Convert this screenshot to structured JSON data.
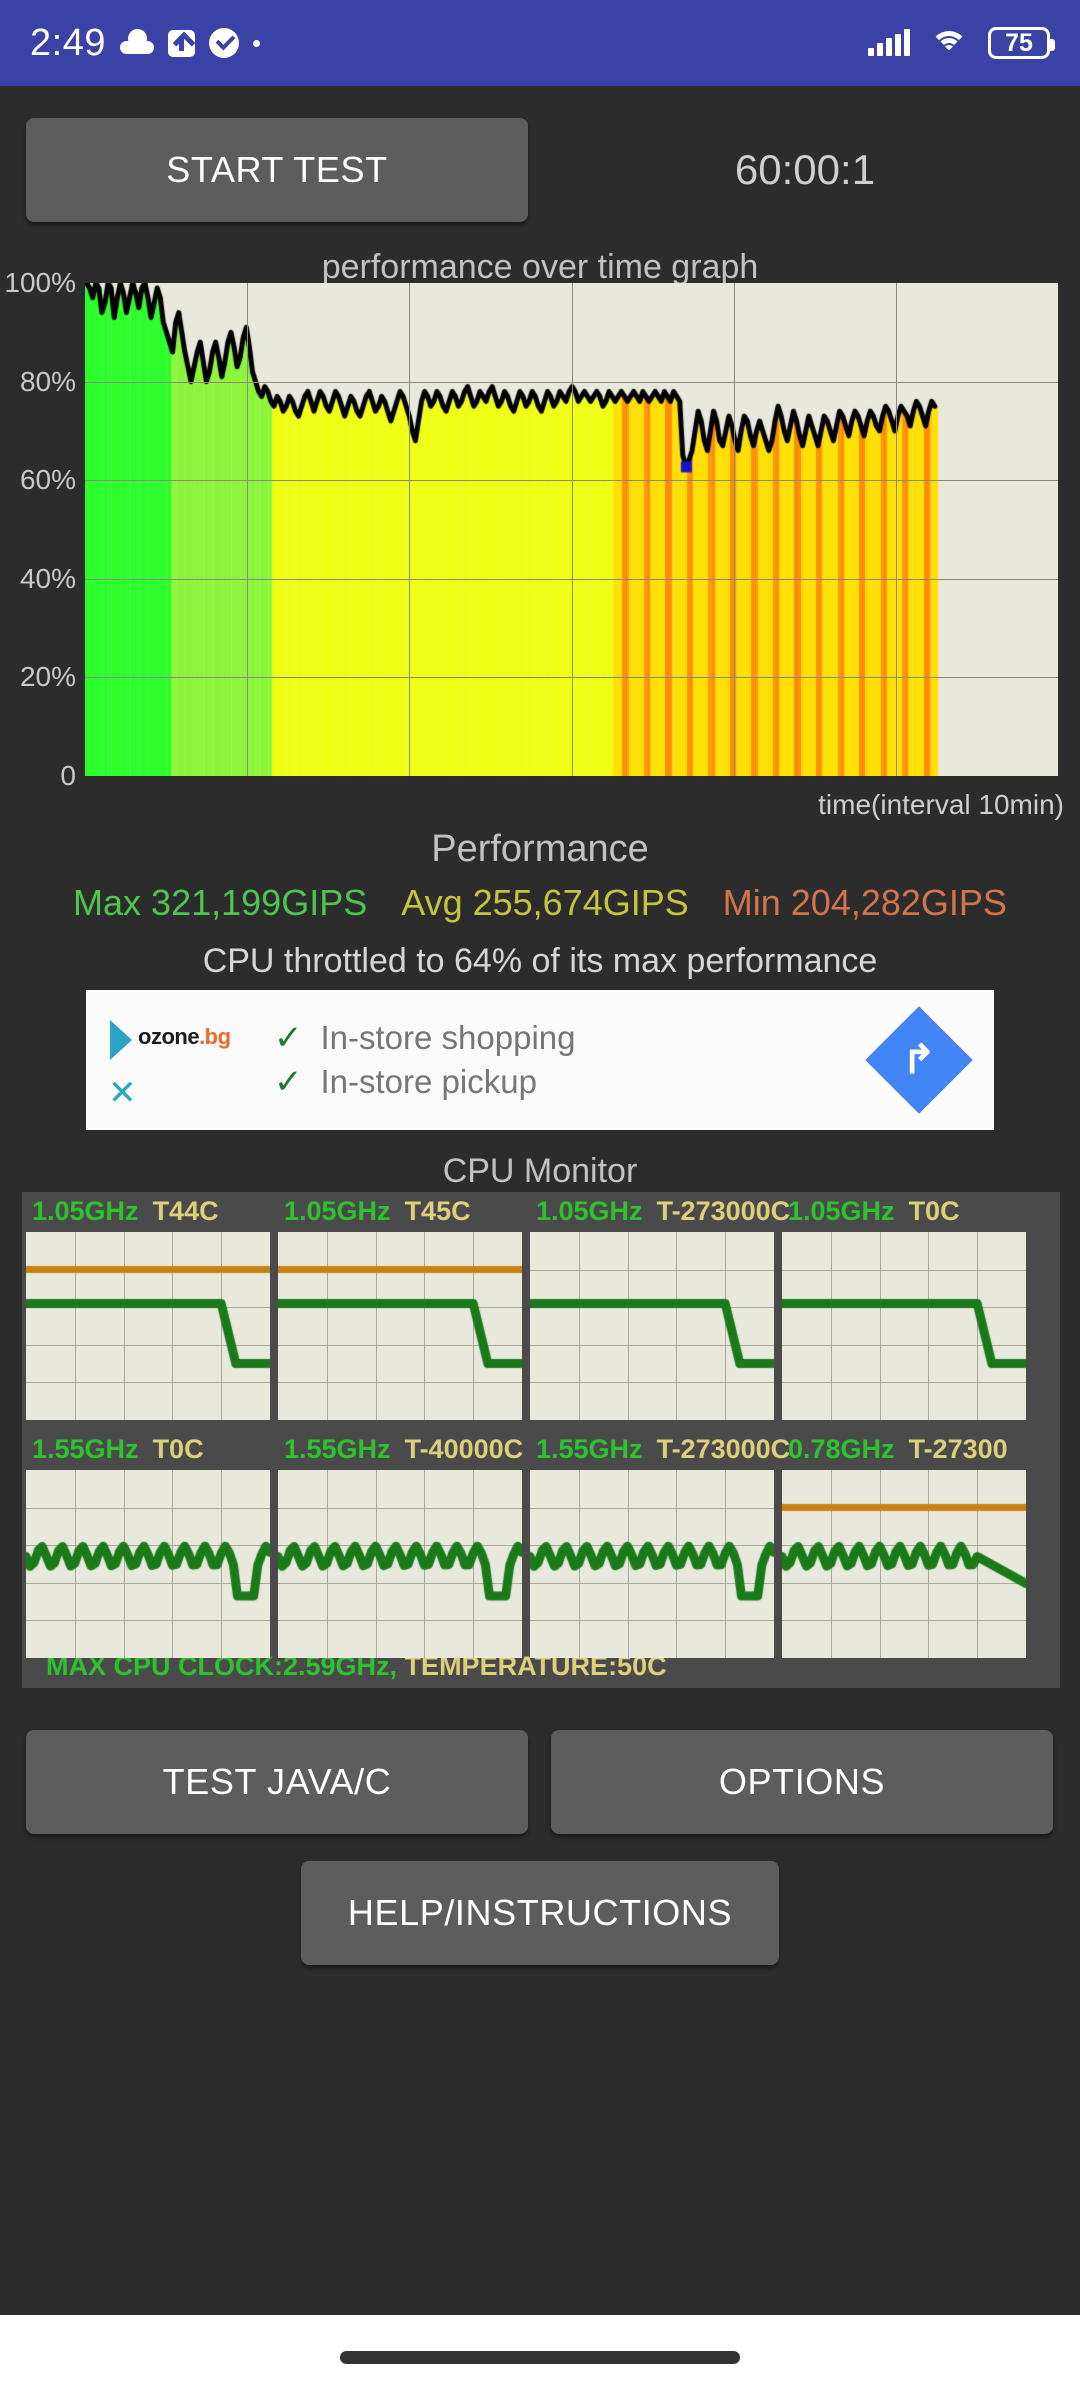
{
  "statusbar": {
    "time": "2:49",
    "battery_level": "75",
    "icons": [
      "cloud-icon",
      "upload-icon",
      "check-circle-icon",
      "dot-icon",
      "signal-icon",
      "wifi-icon",
      "battery-icon"
    ]
  },
  "toolbar": {
    "start_label": "START TEST",
    "timer": "60:00:1"
  },
  "chart_data": {
    "type": "area",
    "title": "performance over time graph",
    "xlabel": "time(interval 10min)",
    "ylabel": "",
    "ylim": [
      0,
      100
    ],
    "ytick_labels": [
      "100%",
      "80%",
      "60%",
      "40%",
      "20%",
      "0"
    ],
    "ytick_values": [
      100,
      80,
      60,
      40,
      20,
      0
    ],
    "xgrid_count": 6,
    "grid": true,
    "plot_background": "#e8e8dc",
    "data_end_fraction": 0.875,
    "series": [
      {
        "name": "performance",
        "values": [
          100,
          99,
          97,
          100,
          99,
          94,
          96,
          100,
          99,
          93,
          97,
          100,
          98,
          94,
          97,
          100,
          98,
          95,
          99,
          100,
          97,
          93,
          96,
          99,
          97,
          92,
          90,
          88,
          86,
          92,
          94,
          90,
          86,
          83,
          80,
          83,
          86,
          88,
          84,
          80,
          82,
          86,
          88,
          85,
          81,
          84,
          88,
          90,
          87,
          83,
          85,
          89,
          91,
          87,
          82,
          80,
          78,
          77,
          79,
          78,
          76,
          75,
          77,
          76,
          74,
          75,
          77,
          76,
          74,
          73,
          75,
          77,
          78,
          76,
          74,
          76,
          78,
          77,
          75,
          74,
          76,
          78,
          77,
          75,
          73,
          75,
          77,
          76,
          74,
          73,
          75,
          77,
          78,
          76,
          74,
          75,
          77,
          76,
          74,
          72,
          74,
          76,
          78,
          77,
          75,
          73,
          70,
          68,
          72,
          76,
          78,
          77,
          75,
          76,
          78,
          77,
          75,
          74,
          76,
          78,
          77,
          75,
          76,
          78,
          79,
          77,
          75,
          76,
          78,
          77,
          76,
          78,
          79,
          77,
          75,
          76,
          78,
          77,
          75,
          74,
          76,
          78,
          77,
          75,
          76,
          78,
          77,
          75,
          74,
          76,
          78,
          77,
          75,
          76,
          78,
          77,
          76,
          78,
          79,
          78,
          76,
          77,
          78,
          77,
          76,
          77,
          78,
          77,
          75,
          76,
          78,
          77,
          76,
          77,
          78,
          77,
          76,
          77,
          78,
          77,
          76,
          78,
          77,
          76,
          77,
          78,
          77,
          76,
          78,
          77,
          76,
          78,
          77,
          76,
          65,
          63,
          64,
          66,
          70,
          74,
          72,
          68,
          66,
          70,
          74,
          72,
          68,
          67,
          70,
          73,
          71,
          68,
          66,
          70,
          73,
          72,
          69,
          67,
          70,
          72,
          70,
          68,
          66,
          68,
          72,
          75,
          73,
          70,
          68,
          71,
          74,
          72,
          69,
          67,
          70,
          73,
          71,
          69,
          67,
          70,
          73,
          72,
          70,
          68,
          71,
          74,
          73,
          71,
          69,
          72,
          74,
          73,
          71,
          69,
          72,
          74,
          73,
          71,
          70,
          73,
          75,
          74,
          72,
          70,
          73,
          75,
          74,
          73,
          71,
          74,
          76,
          75,
          73,
          71,
          74,
          76,
          75
        ]
      }
    ],
    "color_zones": [
      {
        "from": 0.0,
        "to": 0.1,
        "color": "#2aff2a",
        "label": "full-performance-green"
      },
      {
        "from": 0.1,
        "to": 0.22,
        "color": "#8cf53a",
        "label": "high-performance-green"
      },
      {
        "from": 0.22,
        "to": 0.62,
        "color": "#f0ff12",
        "label": "mid-performance-yellow"
      },
      {
        "from": 0.62,
        "to": 0.875,
        "color": "#ffbb00",
        "label": "throttled-orange"
      }
    ]
  },
  "performance": {
    "heading": "Performance",
    "max_label": "Max 321,199GIPS",
    "avg_label": "Avg 255,674GIPS",
    "min_label": "Min 204,282GIPS",
    "max_value": "321,199",
    "avg_value": "255,674",
    "min_value": "204,282",
    "unit": "GIPS",
    "throttle_text": "CPU throttled to 64% of its max performance",
    "throttle_percent": "64",
    "colors": {
      "max": "#4ec64e",
      "avg": "#c4c43e",
      "min": "#d4744c"
    }
  },
  "ad": {
    "brand": "ozone",
    "brand_tld": ".bg",
    "line1": "In-store shopping",
    "line2": "In-store pickup",
    "check_glyph": "✓",
    "close_glyph": "✕",
    "cta_glyph": "↱"
  },
  "cpu_monitor": {
    "heading": "CPU Monitor",
    "cores": [
      {
        "freq": "1.05GHz",
        "temp": "T44C",
        "shape": "step-down"
      },
      {
        "freq": "1.05GHz",
        "temp": "T45C",
        "shape": "step-down"
      },
      {
        "freq": "1.05GHz",
        "temp": "T-273000C",
        "shape": "step-down-notemp"
      },
      {
        "freq": "1.05GHz",
        "temp": "T0C",
        "shape": "step-down-notemp"
      },
      {
        "freq": "1.55GHz",
        "temp": "T0C",
        "shape": "oscillate"
      },
      {
        "freq": "1.55GHz",
        "temp": "T-40000C",
        "shape": "oscillate"
      },
      {
        "freq": "1.55GHz",
        "temp": "T-273000C",
        "shape": "oscillate"
      },
      {
        "freq": "0.78GHz",
        "temp": "T-27300",
        "shape": "oscillate-decline"
      }
    ],
    "footer_clock": "MAX CPU CLOCK:2.59GHz,",
    "footer_temp": "TEMPERATURE:50C"
  },
  "buttons": {
    "test_java_c": "TEST JAVA/C",
    "options": "OPTIONS",
    "help": "HELP/INSTRUCTIONS"
  }
}
